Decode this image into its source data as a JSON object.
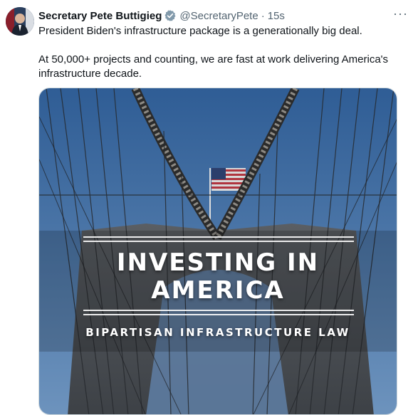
{
  "tweet": {
    "author_name": "Secretary Pete Buttigieg",
    "handle": "@SecretaryPete",
    "separator": "·",
    "time": "15s",
    "more_label": "···",
    "paragraphs": [
      "President Biden's infrastructure package is a generationally big deal.",
      "At 50,000+ projects and counting, we are fast at work delivering America's infrastructure decade."
    ]
  },
  "media": {
    "title_line1": "INVESTING IN",
    "title_line2": "AMERICA",
    "subtitle": "BIPARTISAN INFRASTRUCTURE LAW"
  },
  "icons": {
    "verified": "verified-badge-icon",
    "more": "more-options-icon"
  },
  "colors": {
    "verified": "#829aab",
    "secondary_text": "#536471",
    "sky": "#3e6a9e",
    "stone": "#4a4f55"
  }
}
